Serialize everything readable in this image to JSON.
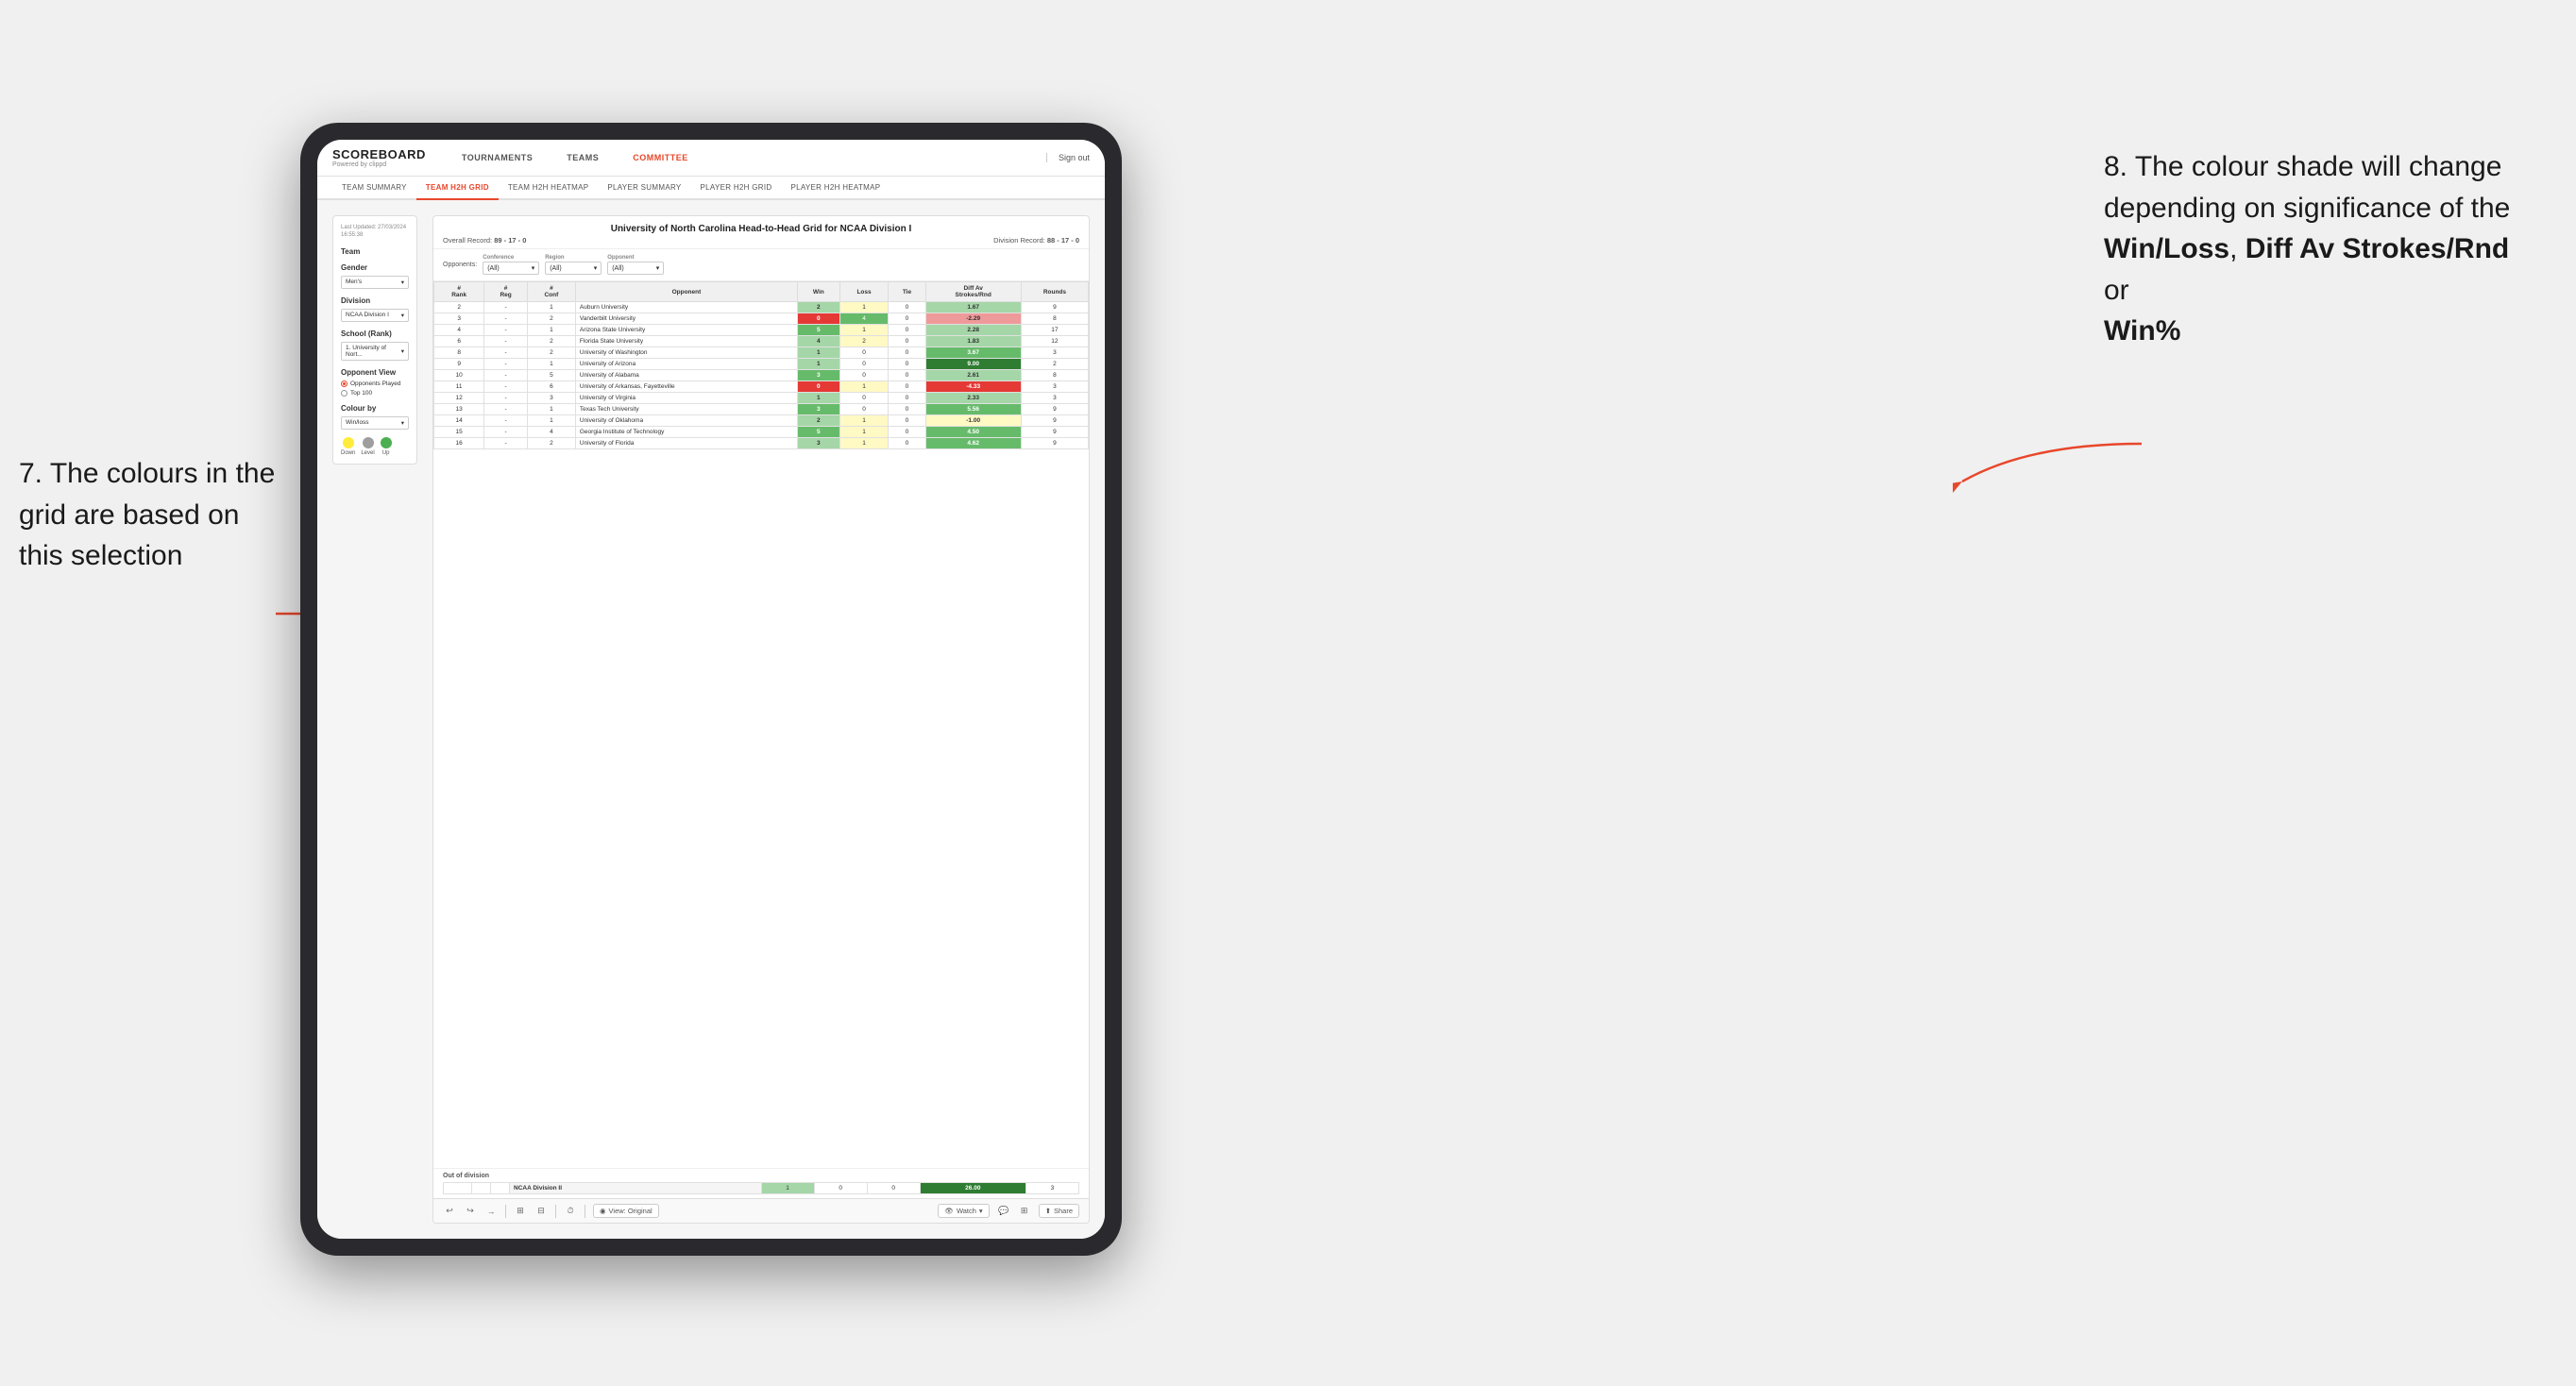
{
  "page": {
    "background": "#f0f0f0"
  },
  "annotations": {
    "left_title": "7. The colours in the grid are based on this selection",
    "right_title": "8. The colour shade will change depending on significance of the",
    "right_bold1": "Win/Loss",
    "right_comma1": ", ",
    "right_bold2": "Diff Av Strokes/Rnd",
    "right_or": " or",
    "right_bold3": "Win%"
  },
  "nav": {
    "logo": "SCOREBOARD",
    "logo_sub": "Powered by clippd",
    "items": [
      {
        "label": "TOURNAMENTS",
        "active": false
      },
      {
        "label": "TEAMS",
        "active": false
      },
      {
        "label": "COMMITTEE",
        "active": true
      }
    ],
    "sign_out": "Sign out"
  },
  "sub_nav": {
    "items": [
      {
        "label": "TEAM SUMMARY",
        "active": false
      },
      {
        "label": "TEAM H2H GRID",
        "active": true
      },
      {
        "label": "TEAM H2H HEATMAP",
        "active": false
      },
      {
        "label": "PLAYER SUMMARY",
        "active": false
      },
      {
        "label": "PLAYER H2H GRID",
        "active": false
      },
      {
        "label": "PLAYER H2H HEATMAP",
        "active": false
      }
    ]
  },
  "sidebar": {
    "last_updated": "Last Updated: 27/03/2024\n16:55:38",
    "team_label": "Team",
    "gender_label": "Gender",
    "gender_value": "Men's",
    "division_label": "Division",
    "division_value": "NCAA Division I",
    "school_label": "School (Rank)",
    "school_value": "1. University of Nort...",
    "opponent_view_label": "Opponent View",
    "radio_opponents": "Opponents Played",
    "radio_top100": "Top 100",
    "colour_by_label": "Colour by",
    "colour_by_value": "Win/loss",
    "legend_down": "Down",
    "legend_level": "Level",
    "legend_up": "Up"
  },
  "grid": {
    "title": "University of North Carolina Head-to-Head Grid for NCAA Division I",
    "overall_record_label": "Overall Record:",
    "overall_record_value": "89 - 17 - 0",
    "division_record_label": "Division Record:",
    "division_record_value": "88 - 17 - 0",
    "filters": {
      "conference_label": "Conference",
      "conference_value": "(All)",
      "region_label": "Region",
      "region_value": "(All)",
      "opponent_label": "Opponent",
      "opponent_value": "(All)"
    },
    "opponents_label": "Opponents:",
    "columns": [
      {
        "label": "#\nRank"
      },
      {
        "label": "#\nReg"
      },
      {
        "label": "#\nConf"
      },
      {
        "label": "Opponent"
      },
      {
        "label": "Win"
      },
      {
        "label": "Loss"
      },
      {
        "label": "Tie"
      },
      {
        "label": "Diff Av\nStrokes/Rnd"
      },
      {
        "label": "Rounds"
      }
    ],
    "rows": [
      {
        "rank": "2",
        "reg": "-",
        "conf": "1",
        "opponent": "Auburn University",
        "win": "2",
        "loss": "1",
        "tie": "0",
        "diff": "1.67",
        "rounds": "9",
        "win_color": "green-light",
        "loss_color": "yellow-light",
        "diff_color": "green-light"
      },
      {
        "rank": "3",
        "reg": "-",
        "conf": "2",
        "opponent": "Vanderbilt University",
        "win": "0",
        "loss": "4",
        "tie": "0",
        "diff": "-2.29",
        "rounds": "8",
        "win_color": "red",
        "loss_color": "green",
        "diff_color": "red-light"
      },
      {
        "rank": "4",
        "reg": "-",
        "conf": "1",
        "opponent": "Arizona State University",
        "win": "5",
        "loss": "1",
        "tie": "0",
        "diff": "2.28",
        "rounds": "17",
        "win_color": "green",
        "loss_color": "yellow-light",
        "diff_color": "green-light"
      },
      {
        "rank": "6",
        "reg": "-",
        "conf": "2",
        "opponent": "Florida State University",
        "win": "4",
        "loss": "2",
        "tie": "0",
        "diff": "1.83",
        "rounds": "12",
        "win_color": "green-light",
        "loss_color": "yellow-light",
        "diff_color": "green-light"
      },
      {
        "rank": "8",
        "reg": "-",
        "conf": "2",
        "opponent": "University of Washington",
        "win": "1",
        "loss": "0",
        "tie": "0",
        "diff": "3.67",
        "rounds": "3",
        "win_color": "green-light",
        "loss_color": "white",
        "diff_color": "green"
      },
      {
        "rank": "9",
        "reg": "-",
        "conf": "1",
        "opponent": "University of Arizona",
        "win": "1",
        "loss": "0",
        "tie": "0",
        "diff": "9.00",
        "rounds": "2",
        "win_color": "green-light",
        "loss_color": "white",
        "diff_color": "green-dark"
      },
      {
        "rank": "10",
        "reg": "-",
        "conf": "5",
        "opponent": "University of Alabama",
        "win": "3",
        "loss": "0",
        "tie": "0",
        "diff": "2.61",
        "rounds": "8",
        "win_color": "green",
        "loss_color": "white",
        "diff_color": "green-light"
      },
      {
        "rank": "11",
        "reg": "-",
        "conf": "6",
        "opponent": "University of Arkansas, Fayetteville",
        "win": "0",
        "loss": "1",
        "tie": "0",
        "diff": "-4.33",
        "rounds": "3",
        "win_color": "red",
        "loss_color": "yellow-light",
        "diff_color": "red"
      },
      {
        "rank": "12",
        "reg": "-",
        "conf": "3",
        "opponent": "University of Virginia",
        "win": "1",
        "loss": "0",
        "tie": "0",
        "diff": "2.33",
        "rounds": "3",
        "win_color": "green-light",
        "loss_color": "white",
        "diff_color": "green-light"
      },
      {
        "rank": "13",
        "reg": "-",
        "conf": "1",
        "opponent": "Texas Tech University",
        "win": "3",
        "loss": "0",
        "tie": "0",
        "diff": "5.56",
        "rounds": "9",
        "win_color": "green",
        "loss_color": "white",
        "diff_color": "green"
      },
      {
        "rank": "14",
        "reg": "-",
        "conf": "1",
        "opponent": "University of Oklahoma",
        "win": "2",
        "loss": "1",
        "tie": "0",
        "diff": "-1.00",
        "rounds": "9",
        "win_color": "green-light",
        "loss_color": "yellow-light",
        "diff_color": "yellow-light"
      },
      {
        "rank": "15",
        "reg": "-",
        "conf": "4",
        "opponent": "Georgia Institute of Technology",
        "win": "5",
        "loss": "1",
        "tie": "0",
        "diff": "4.50",
        "rounds": "9",
        "win_color": "green",
        "loss_color": "yellow-light",
        "diff_color": "green"
      },
      {
        "rank": "16",
        "reg": "-",
        "conf": "2",
        "opponent": "University of Florida",
        "win": "3",
        "loss": "1",
        "tie": "0",
        "diff": "4.62",
        "rounds": "9",
        "win_color": "green-light",
        "loss_color": "yellow-light",
        "diff_color": "green"
      }
    ],
    "out_of_division_label": "Out of division",
    "out_of_division_row": {
      "division": "NCAA Division II",
      "win": "1",
      "loss": "0",
      "tie": "0",
      "diff": "26.00",
      "rounds": "3"
    }
  },
  "toolbar": {
    "view_original": "View: Original",
    "watch": "Watch",
    "share": "Share"
  }
}
